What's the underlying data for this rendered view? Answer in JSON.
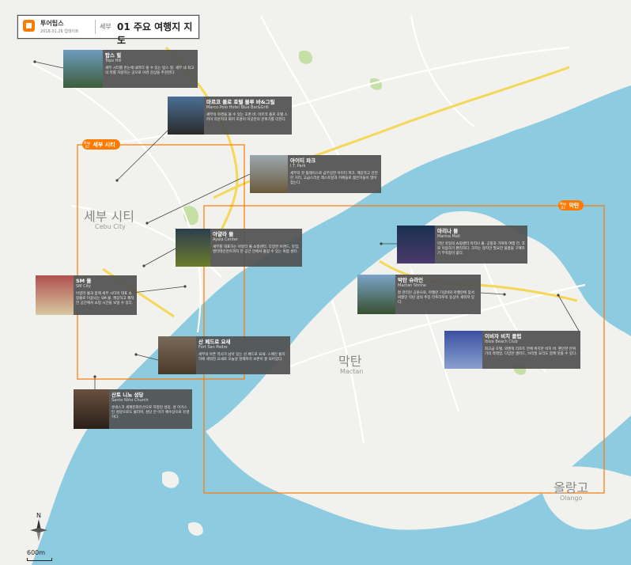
{
  "header": {
    "brand": "투어팁스",
    "updated": "2018.01.26 업데이트",
    "region": "세부",
    "title": "01 주요 여행지 지도"
  },
  "areas": [
    {
      "map_no_label": "Map",
      "map_no": "02",
      "name": "세부 시티"
    },
    {
      "map_no_label": "Map",
      "map_no": "03",
      "name": "막탄"
    }
  ],
  "city_labels": {
    "cebu_ko": "세부 시티",
    "cebu_en": "Cebu City",
    "mactan_ko": "막탄",
    "mactan_en": "Mactan",
    "olango_ko": "올랑고",
    "olango_en": "Olango"
  },
  "places": [
    {
      "name": "탑스 힐",
      "en": "Tops Hill",
      "desc": "세부 시티를 한눈에 내려다 볼 수 있는 탑스 힐. 세부 내 최고의 뷰를 자랑하는 곳으로 야경 감상을 추천한다."
    },
    {
      "name": "마르코 폴로 호텔 블루 바&그릴",
      "en": "Marco Polo Hotel Blue Bar&Grill",
      "desc": "세부의 야경을 볼 수 있는 호존 바. 마르코 폴로 호텔 스카이 라운지의 화려 조명이 이곳만의 분위기를 더한다."
    },
    {
      "name": "아이티 파크",
      "en": "I.T. Park",
      "desc": "세부의 핫 플레이스로 급부상한 아이티 파크. 깨끗하고 안전한 거리, 고급스러운 레스토랑과 카페들로 젊은이들이 많이 찾는다."
    },
    {
      "name": "아얄라 몰",
      "en": "Ayala Center",
      "desc": "세부를 대표하는 아얄라 몰 쇼핑센터. 다양한 브랜드, 맛집, 엔터테인먼트까지 한 공간 안에서 즐길 수 있는 복합 센터."
    },
    {
      "name": "SM 몰",
      "en": "SM City",
      "desc": "아얄라 몰과 함께 세부 시티의 대표 쇼핑몰로 이용되는 SM 몰. 깨끗하고 쾌적한 공간에서 쇼핑 시간을 보낼 수 있다."
    },
    {
      "name": "산 페드로 요새",
      "en": "Fort San Pedro",
      "desc": "세부의 아픈 역사가 남아 있는 산 페드로 요새. 스페인 통치 하에 세워진 요새로 오늘날 현재까지 보존이 잘 되어있다."
    },
    {
      "name": "산토 니뇨 성당",
      "en": "Santo Niño Church",
      "desc": "유네스코 세계문화유산으로 지정된 성당. 성 어거스틴 성당으로도 불리며, 성당 안 아기 예수상으로 유명하다."
    },
    {
      "name": "마리나 몰",
      "en": "Marina Mall",
      "desc": "막탄 유일의 쇼핑센터 마리나 몰. 공항과 가까워 여행 전, 후로 이용하기 편리하다. 크지는 않지만 필요한 물품을 구매하기 부족함이 없다."
    },
    {
      "name": "막탄 슈라인",
      "en": "Mactan Shrine",
      "desc": "잘 관리된 공원으로, 마젤란 기념비와 마젤란에 맞서 싸웠던 막탄 섬의 추장 라푸라푸의 동상이 세워져 있다."
    },
    {
      "name": "이비자 비치 클럽",
      "en": "Ibiza Beach Club",
      "desc": "최고급 호텔, 뫼벤픽 리조트 안에 위치한 비치 바. 편안한 분위기의 칵테일, 다양한 샐러드, 브라질 요리도 함께 맛볼 수 있다."
    }
  ],
  "compass": {
    "north": "N"
  },
  "scale": {
    "label": "600m"
  },
  "colors": {
    "sea": "#8ccbe0",
    "land": "#f1f1ee",
    "accent": "#ff7a00",
    "road": "#f5d858",
    "callout": "#505050"
  }
}
